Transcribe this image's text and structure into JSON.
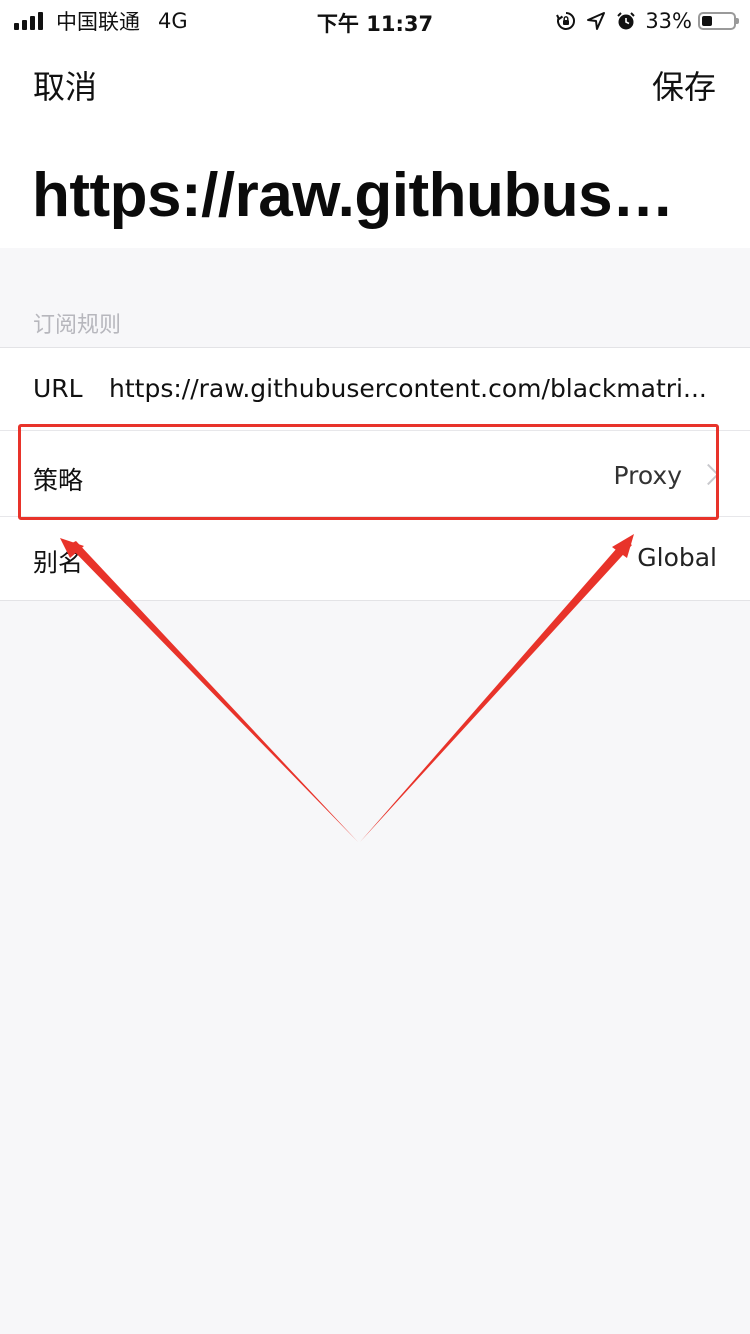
{
  "status_bar": {
    "carrier": "中国联通",
    "network": "4G",
    "time": "下午 11:37",
    "battery_percent": "33%",
    "battery_level": 0.33,
    "icons": [
      "signal-icon",
      "orientation-lock-icon",
      "location-icon",
      "alarm-icon",
      "battery-icon"
    ]
  },
  "nav": {
    "cancel_label": "取消",
    "save_label": "保存"
  },
  "title": "https://raw.githubuser...",
  "section": {
    "header": "订阅规则",
    "rows": {
      "url": {
        "label": "URL",
        "value": "https://raw.githubusercontent.com/blackmatri..."
      },
      "policy": {
        "label": "策略",
        "value": "Proxy"
      },
      "alias": {
        "label": "别名",
        "value": "Global"
      }
    }
  },
  "annotation": {
    "color": "#e8332a"
  }
}
